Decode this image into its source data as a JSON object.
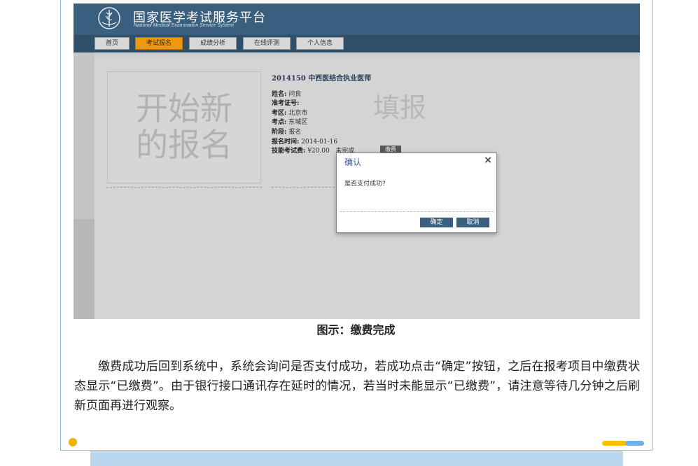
{
  "header": {
    "title": "国家医学考试服务平台",
    "subtitle": "National Medical Examination Service System"
  },
  "nav": {
    "items": [
      "首页",
      "考试报名",
      "成绩分析",
      "在线评测",
      "个人信息"
    ],
    "active": "考试报名"
  },
  "new_registration": {
    "text": "开始新的报名"
  },
  "exam": {
    "title": "2014150 中西医结合执业医师",
    "fields": [
      {
        "label": "姓名:",
        "value": "问良"
      },
      {
        "label": "准考证号:",
        "value": ""
      },
      {
        "label": "考区:",
        "value": "北京市"
      },
      {
        "label": "考点:",
        "value": "东城区"
      },
      {
        "label": "阶段:",
        "value": "报名"
      },
      {
        "label": "报名时间:",
        "value": "2014-01-16"
      },
      {
        "label": "技能考试费:",
        "value": "¥20.00"
      }
    ],
    "fee_status": "未完成",
    "pay_label": "缴费",
    "fill_label": "填报"
  },
  "dialog": {
    "title": "确认",
    "message": "是否支付成功?",
    "ok_label": "确定",
    "cancel_label": "取消"
  },
  "caption": "图示：缴费完成",
  "paragraph": "缴费成功后回到系统中，系统会询问是否支付成功，若成功点击“确定”按钮，之后在报考项目中缴费状态显示“已缴费”。由于银行接口通讯存在延时的情况，若当时未能显示“已缴费”，请注意等待几分钟之后刷新页面再进行观察。",
  "colors": {
    "header_bg": "#3a5f7e",
    "nav_active": "#f0960f",
    "accent_blue": "#8fb8de",
    "dot_yellow": "#f2b400"
  }
}
